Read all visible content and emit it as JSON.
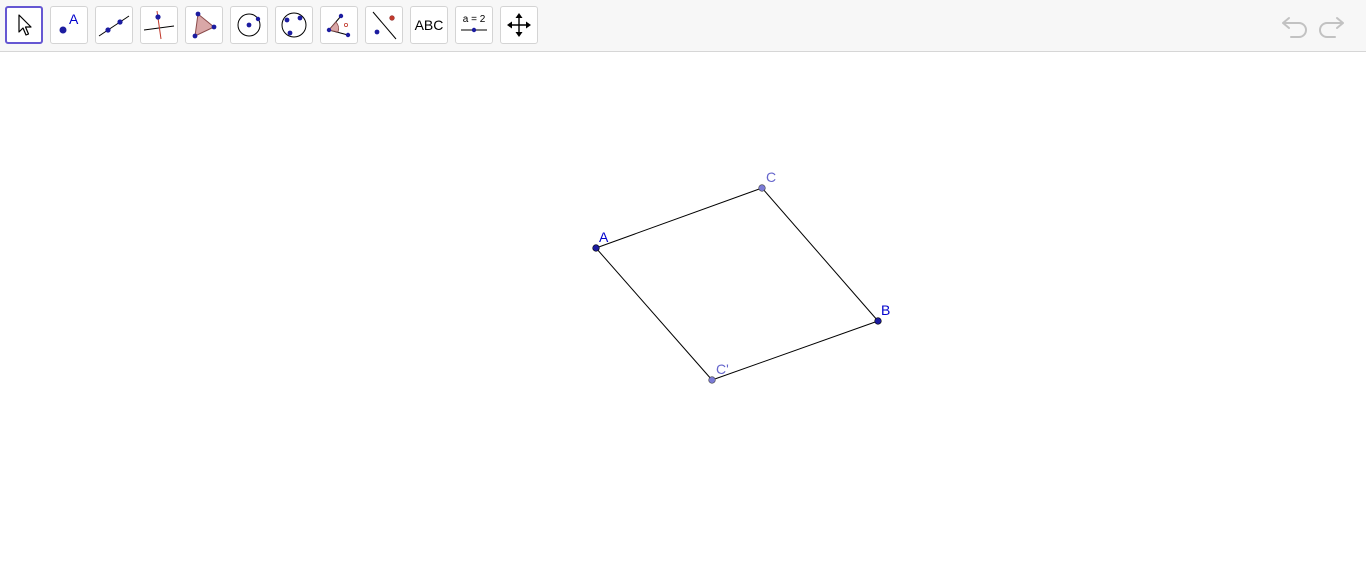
{
  "app": {
    "toolbar_tools": [
      {
        "name": "move-tool",
        "icon": "cursor-arrow-icon",
        "selected": true
      },
      {
        "name": "point-tool",
        "icon": "point-icon",
        "label": "A"
      },
      {
        "name": "line-tool",
        "icon": "line-icon"
      },
      {
        "name": "perpendicular-line-tool",
        "icon": "perpendicular-line-icon"
      },
      {
        "name": "polygon-tool",
        "icon": "polygon-icon"
      },
      {
        "name": "circle-center-point-tool",
        "icon": "circle-center-icon"
      },
      {
        "name": "circle-three-points-tool",
        "icon": "circle-three-points-icon"
      },
      {
        "name": "angle-tool",
        "icon": "angle-icon"
      },
      {
        "name": "reflect-about-line-tool",
        "icon": "reflect-icon"
      },
      {
        "name": "text-tool",
        "icon": "text-icon",
        "label": "ABC"
      },
      {
        "name": "slider-tool",
        "icon": "slider-icon",
        "label": "a = 2"
      },
      {
        "name": "move-graphics-view-tool",
        "icon": "move-view-icon"
      }
    ],
    "undo_icon": "undo-icon",
    "redo_icon": "redo-icon"
  },
  "construction": {
    "points": {
      "A": {
        "label": "A",
        "color": "#0000cc"
      },
      "B": {
        "label": "B",
        "color": "#0000cc"
      },
      "C": {
        "label": "C",
        "color": "#6666cc"
      },
      "C_prime": {
        "label": "C'",
        "color": "#6666cc"
      }
    },
    "segment_color": "#000000",
    "accent_color": "#6557d2"
  }
}
